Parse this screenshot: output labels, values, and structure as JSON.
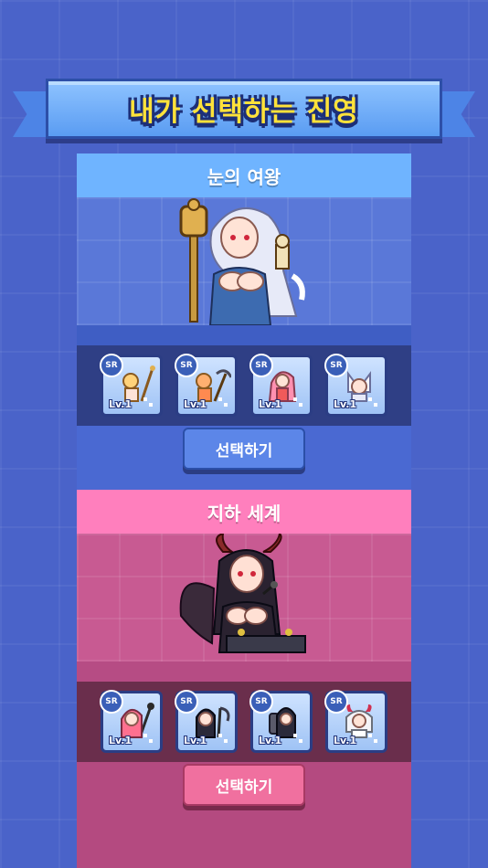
{
  "title": "내가 선택하는 진영",
  "factions": [
    {
      "name": "눈의 여왕",
      "select_label": "선택하기",
      "colors": {
        "header": "#6fb4ff",
        "body": "#5a78d8",
        "row": "#2f3f85",
        "button": "#5c86e8"
      },
      "characters": [
        {
          "rarity": "SR",
          "level": "Lv.1",
          "icon": "staff-girl-icon"
        },
        {
          "rarity": "SR",
          "level": "Lv.1",
          "icon": "pickaxe-girl-icon"
        },
        {
          "rarity": "SR",
          "level": "Lv.1",
          "icon": "pink-hair-girl-icon"
        },
        {
          "rarity": "SR",
          "level": "Lv.1",
          "icon": "cat-girl-icon"
        }
      ]
    },
    {
      "name": "지하 세계",
      "select_label": "선택하기",
      "colors": {
        "header": "#ff7fbd",
        "body": "#c85a92",
        "row": "#6a2e4c",
        "button": "#f0709f"
      },
      "characters": [
        {
          "rarity": "SR",
          "level": "Lv.1",
          "icon": "mage-girl-icon"
        },
        {
          "rarity": "SR",
          "level": "Lv.1",
          "icon": "scythe-girl-icon"
        },
        {
          "rarity": "SR",
          "level": "Lv.1",
          "icon": "knight-icon"
        },
        {
          "rarity": "SR",
          "level": "Lv.1",
          "icon": "horned-girl-icon"
        }
      ]
    }
  ]
}
